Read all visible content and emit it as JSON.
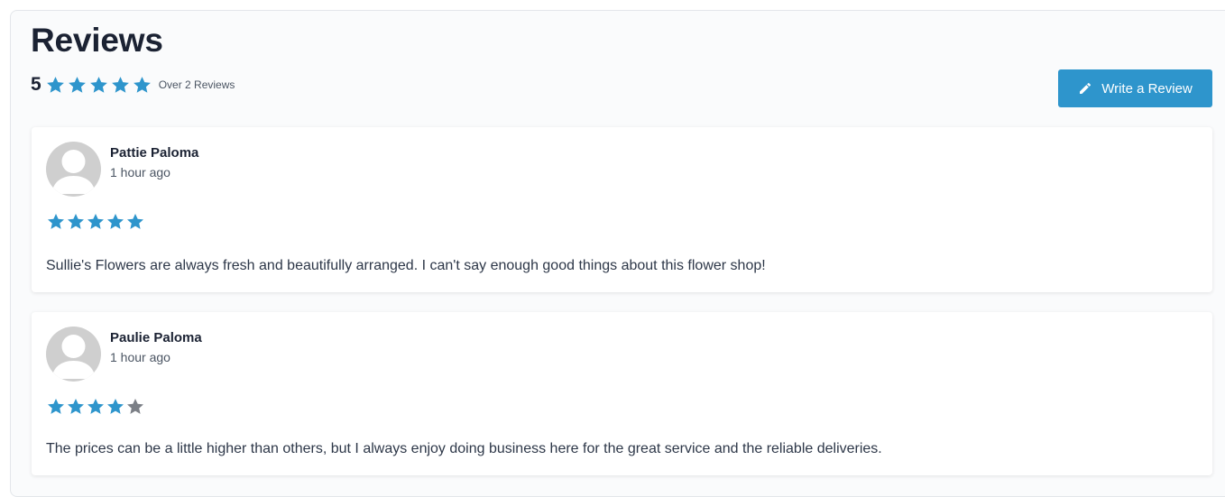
{
  "header": {
    "title": "Reviews",
    "average_rating": "5",
    "average_rating_value": 5,
    "max_stars": 5,
    "count_text": "Over 2 Reviews"
  },
  "write_button": {
    "label": "Write a Review",
    "icon": "pencil-icon"
  },
  "colors": {
    "accent": "#2e95cc",
    "star_filled": "#2e95cc",
    "star_empty": "#7b7f86",
    "avatar_bg": "#cfcfcf"
  },
  "reviews": [
    {
      "author": "Pattie Paloma",
      "time": "1 hour ago",
      "rating": 5,
      "text": "Sullie's Flowers are always fresh and beautifully arranged. I can't say enough good things about this flower shop!"
    },
    {
      "author": "Paulie Paloma",
      "time": "1 hour ago",
      "rating": 4,
      "text": "The prices can be a little higher than others, but I always enjoy doing business here for the great service and the reliable deliveries."
    }
  ]
}
